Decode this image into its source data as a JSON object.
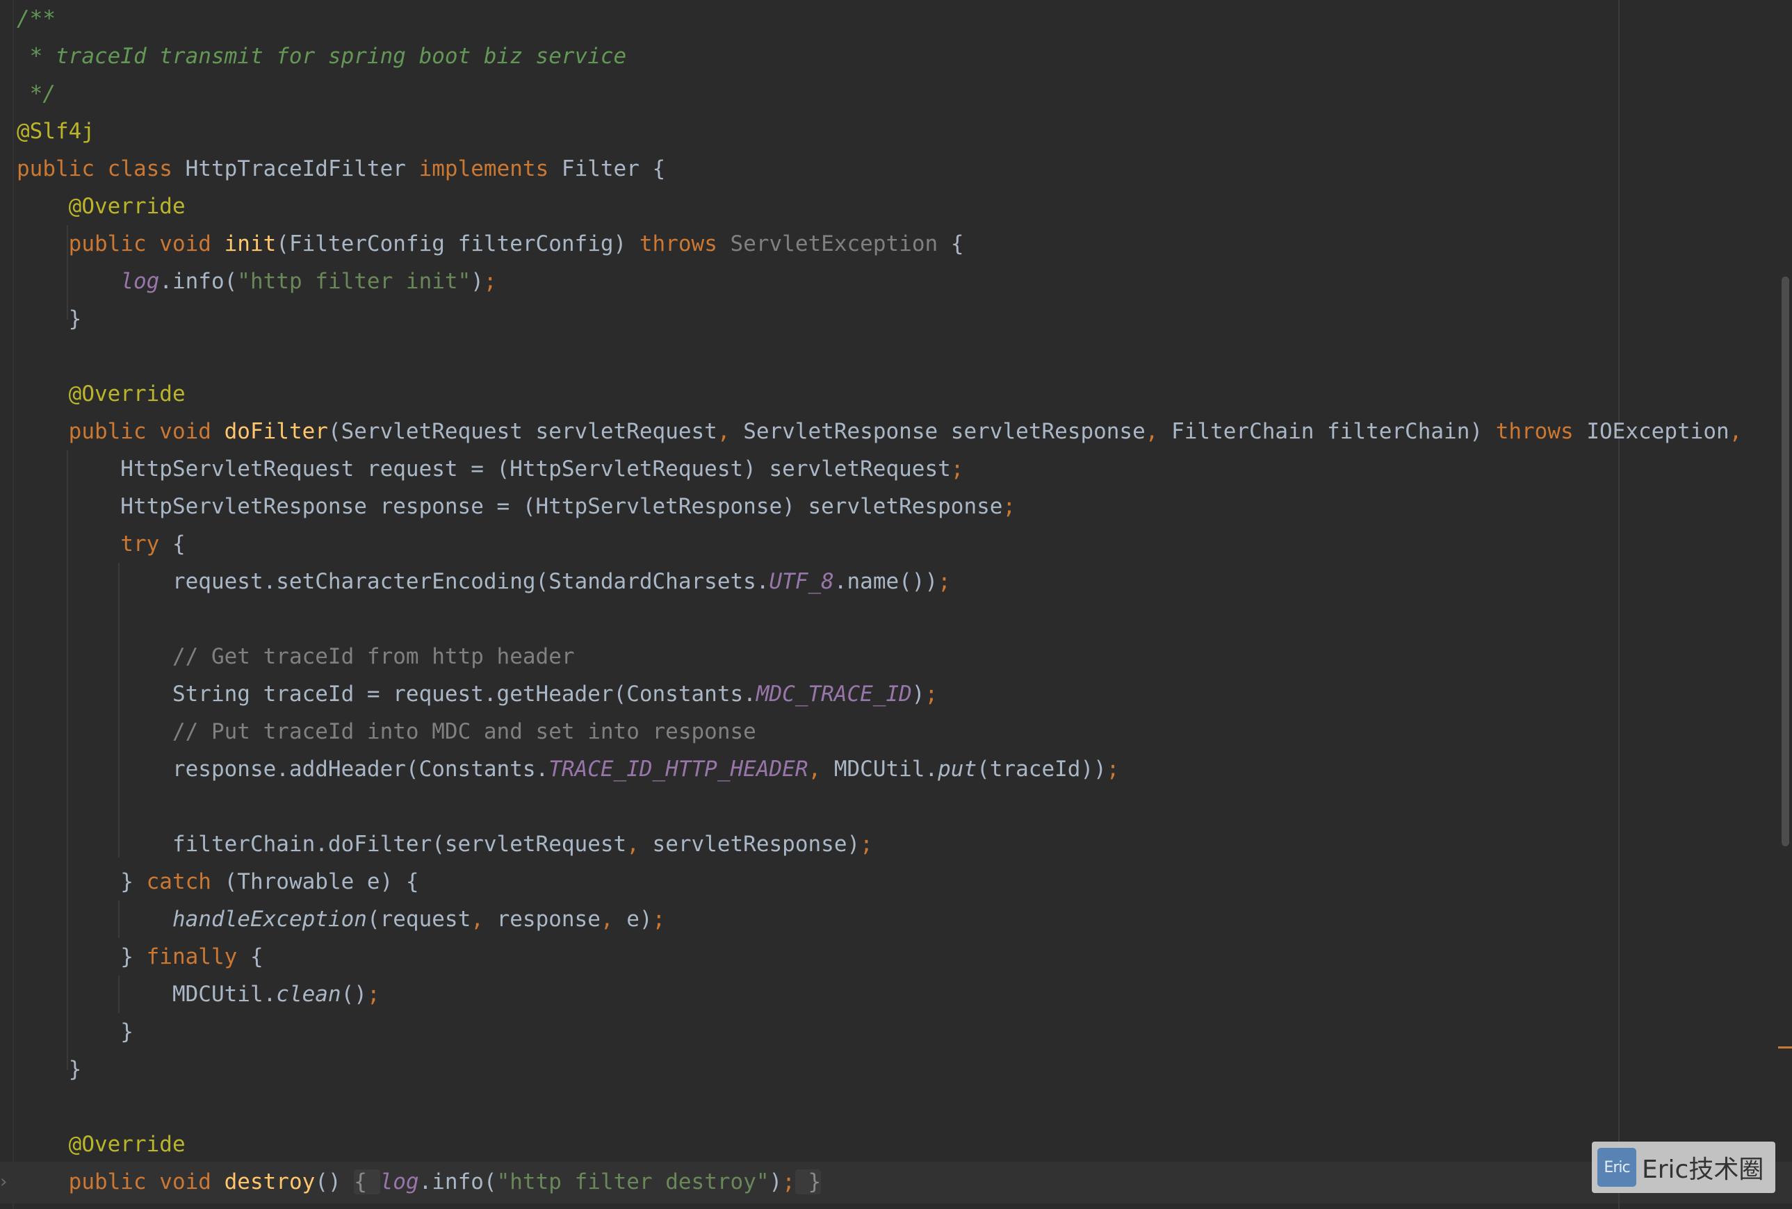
{
  "editor": {
    "lines": [
      [
        [
          "/**",
          "doc"
        ]
      ],
      [
        [
          " * traceId transmit for spring boot biz service",
          "doc"
        ]
      ],
      [
        [
          " */",
          "doc"
        ]
      ],
      [
        [
          "@Slf4j",
          "ann"
        ]
      ],
      [
        [
          "public class ",
          "kw"
        ],
        [
          "HttpTraceIdFilter ",
          "type"
        ],
        [
          "implements ",
          "kw"
        ],
        [
          "Filter {",
          "txt"
        ]
      ],
      [
        [
          "    ",
          "txt"
        ],
        [
          "@Override",
          "ann"
        ]
      ],
      [
        [
          "    ",
          "txt"
        ],
        [
          "public void ",
          "kw"
        ],
        [
          "init",
          "fn"
        ],
        [
          "(FilterConfig filterConfig) ",
          "txt"
        ],
        [
          "throws ",
          "kw"
        ],
        [
          "ServletException",
          "dim"
        ],
        [
          " {",
          "txt"
        ]
      ],
      [
        [
          "        ",
          "txt"
        ],
        [
          "log",
          "fld"
        ],
        [
          ".info(",
          "txt"
        ],
        [
          "\"http filter init\"",
          "str"
        ],
        [
          ")",
          "txt"
        ],
        [
          ";",
          "sep"
        ]
      ],
      [
        [
          "    }",
          "txt"
        ]
      ],
      [],
      [
        [
          "    ",
          "txt"
        ],
        [
          "@Override",
          "ann"
        ]
      ],
      [
        [
          "    ",
          "txt"
        ],
        [
          "public void ",
          "kw"
        ],
        [
          "doFilter",
          "fn"
        ],
        [
          "(ServletRequest servletRequest",
          "txt"
        ],
        [
          ", ",
          "sep"
        ],
        [
          "ServletResponse servletResponse",
          "txt"
        ],
        [
          ", ",
          "sep"
        ],
        [
          "FilterChain filterChain) ",
          "txt"
        ],
        [
          "throws ",
          "kw"
        ],
        [
          "IOException",
          "txt"
        ],
        [
          ",",
          "sep"
        ]
      ],
      [
        [
          "        HttpServletRequest request = (HttpServletRequest) servletRequest",
          "txt"
        ],
        [
          ";",
          "sep"
        ]
      ],
      [
        [
          "        HttpServletResponse response = (HttpServletResponse) servletResponse",
          "txt"
        ],
        [
          ";",
          "sep"
        ]
      ],
      [
        [
          "        ",
          "txt"
        ],
        [
          "try ",
          "kw"
        ],
        [
          "{",
          "txt"
        ]
      ],
      [
        [
          "            request.setCharacterEncoding(StandardCharsets.",
          "txt"
        ],
        [
          "UTF_8",
          "fld"
        ],
        [
          ".name())",
          "txt"
        ],
        [
          ";",
          "sep"
        ]
      ],
      [],
      [
        [
          "            ",
          "txt"
        ],
        [
          "// Get traceId from http header",
          "cmt"
        ]
      ],
      [
        [
          "            String traceId = request.getHeader(Constants.",
          "txt"
        ],
        [
          "MDC_TRACE_ID",
          "fld"
        ],
        [
          ")",
          "txt"
        ],
        [
          ";",
          "sep"
        ]
      ],
      [
        [
          "            ",
          "txt"
        ],
        [
          "// Put traceId into MDC and set into response",
          "cmt"
        ]
      ],
      [
        [
          "            response.addHeader(Constants.",
          "txt"
        ],
        [
          "TRACE_ID_HTTP_HEADER",
          "fld"
        ],
        [
          ", ",
          "sep"
        ],
        [
          "MDCUtil.",
          "txt"
        ],
        [
          "put",
          "sfn"
        ],
        [
          "(traceId))",
          "txt"
        ],
        [
          ";",
          "sep"
        ]
      ],
      [],
      [
        [
          "            filterChain.doFilter(servletRequest",
          "txt"
        ],
        [
          ", ",
          "sep"
        ],
        [
          "servletResponse)",
          "txt"
        ],
        [
          ";",
          "sep"
        ]
      ],
      [
        [
          "        } ",
          "txt"
        ],
        [
          "catch ",
          "kw"
        ],
        [
          "(Throwable e) {",
          "txt"
        ]
      ],
      [
        [
          "            ",
          "txt"
        ],
        [
          "handleException",
          "sfn"
        ],
        [
          "(request",
          "txt"
        ],
        [
          ", ",
          "sep"
        ],
        [
          "response",
          "txt"
        ],
        [
          ", ",
          "sep"
        ],
        [
          "e)",
          "txt"
        ],
        [
          ";",
          "sep"
        ]
      ],
      [
        [
          "        } ",
          "txt"
        ],
        [
          "finally ",
          "kw"
        ],
        [
          "{",
          "txt"
        ]
      ],
      [
        [
          "            MDCUtil.",
          "txt"
        ],
        [
          "clean",
          "sfn"
        ],
        [
          "()",
          "txt"
        ],
        [
          ";",
          "sep"
        ]
      ],
      [
        [
          "        }",
          "txt"
        ]
      ],
      [
        [
          "    }",
          "txt"
        ]
      ],
      [],
      [
        [
          "    ",
          "txt"
        ],
        [
          "@Override",
          "ann"
        ]
      ],
      [
        [
          "    ",
          "txt"
        ],
        [
          "public void ",
          "kw"
        ],
        [
          "destroy",
          "fn"
        ],
        [
          "() ",
          "txt"
        ],
        [
          "{ ",
          "fold"
        ],
        [
          "log",
          "fld"
        ],
        [
          ".info(",
          "txt"
        ],
        [
          "\"http filter destroy\"",
          "str"
        ],
        [
          ")",
          "txt"
        ],
        [
          ";",
          "sep"
        ],
        [
          " }",
          "fold"
        ]
      ]
    ]
  },
  "watermark": {
    "logo_text": "Eric",
    "text": "Eric技术圈"
  },
  "colors": {
    "background": "#2b2b2b",
    "keyword": "#cc7832",
    "annotation": "#bbb529",
    "doc_comment": "#629755",
    "line_comment": "#808080",
    "string": "#6a8759",
    "method": "#ffc66d",
    "static_field": "#9876aa",
    "text": "#a9b7c6"
  }
}
